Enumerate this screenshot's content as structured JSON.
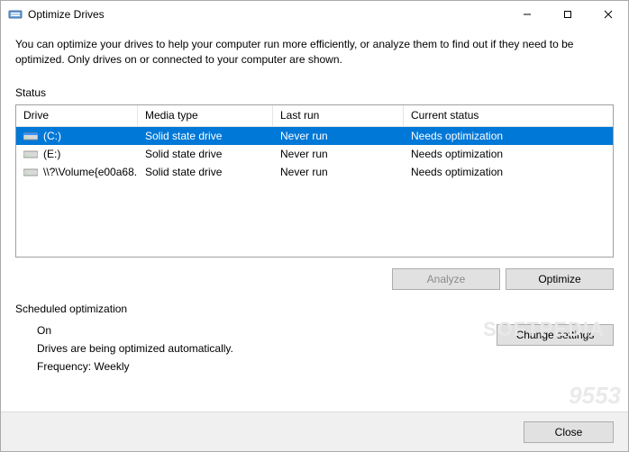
{
  "window": {
    "title": "Optimize Drives"
  },
  "description": "You can optimize your drives to help your computer run more efficiently, or analyze them to find out if they need to be optimized. Only drives on or connected to your computer are shown.",
  "status_label": "Status",
  "table": {
    "headers": {
      "drive": "Drive",
      "media": "Media type",
      "last": "Last run",
      "status": "Current status"
    },
    "rows": [
      {
        "icon": "system-drive",
        "drive": "(C:)",
        "media": "Solid state drive",
        "last": "Never run",
        "status": "Needs optimization",
        "selected": true
      },
      {
        "icon": "drive",
        "drive": "(E:)",
        "media": "Solid state drive",
        "last": "Never run",
        "status": "Needs optimization",
        "selected": false
      },
      {
        "icon": "drive",
        "drive": "\\\\?\\Volume{e00a68...",
        "media": "Solid state drive",
        "last": "Never run",
        "status": "Needs optimization",
        "selected": false
      }
    ]
  },
  "buttons": {
    "analyze": "Analyze",
    "optimize": "Optimize",
    "change_settings": "Change settings",
    "close": "Close"
  },
  "scheduled": {
    "label": "Scheduled optimization",
    "state": "On",
    "desc": "Drives are being optimized automatically.",
    "freq": "Frequency: Weekly"
  },
  "watermarks": {
    "softpedia": "SOFTPEDIA",
    "site": "9553"
  }
}
